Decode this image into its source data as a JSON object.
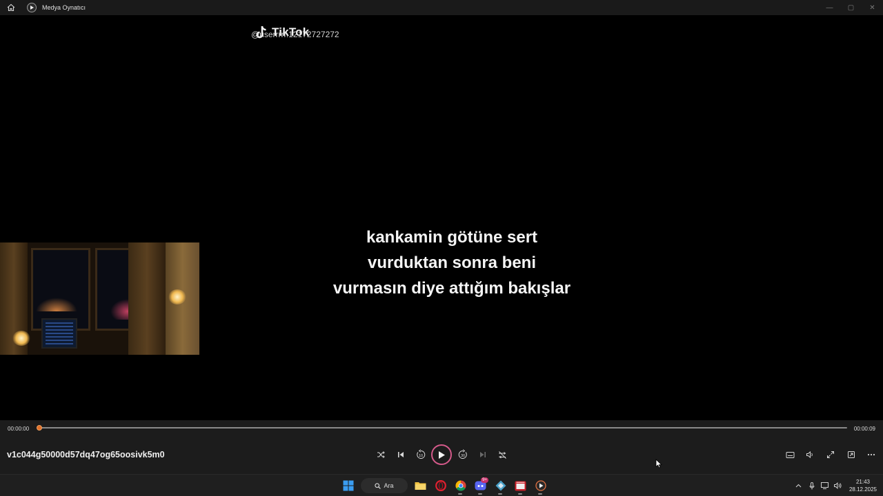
{
  "window": {
    "title": "Medya Oynatıcı",
    "controls": {
      "minimize": "—",
      "maximize": "▢",
      "close": "✕"
    }
  },
  "video": {
    "watermark_brand": "TikTok",
    "watermark_user": "@userrrrr.12172727272",
    "caption_lines": [
      "kankamin götüne sert",
      "vurduktan sonra beni",
      "vurmasın diye attığım bakışlar"
    ]
  },
  "player": {
    "current_time": "00:00:00",
    "total_time": "00:00:09",
    "progress": 0,
    "filename": "v1c044g50000d57dq47og65oosivk5m0",
    "accent_color": "#e0702a",
    "center_buttons": [
      "shuffle-icon",
      "previous-icon",
      "skip-back-10-icon",
      "play-icon",
      "skip-forward-30-icon",
      "next-icon",
      "repeat-off-icon"
    ],
    "skip_back_label": "10",
    "skip_forward_label": "30",
    "right_buttons": [
      "subtitles-icon",
      "volume-icon",
      "fullscreen-icon",
      "mini-player-icon",
      "more-icon"
    ]
  },
  "taskbar": {
    "search_label": "Ara",
    "apps": [
      "windows-start-icon",
      "search-box",
      "file-explorer-icon",
      "opera-icon",
      "chrome-icon",
      "discord-icon",
      "app-icon",
      "media-app-icon",
      "media-player-icon"
    ],
    "discord_badge": "9+",
    "clock_time": "21:43",
    "clock_date": "28.12.2025"
  }
}
